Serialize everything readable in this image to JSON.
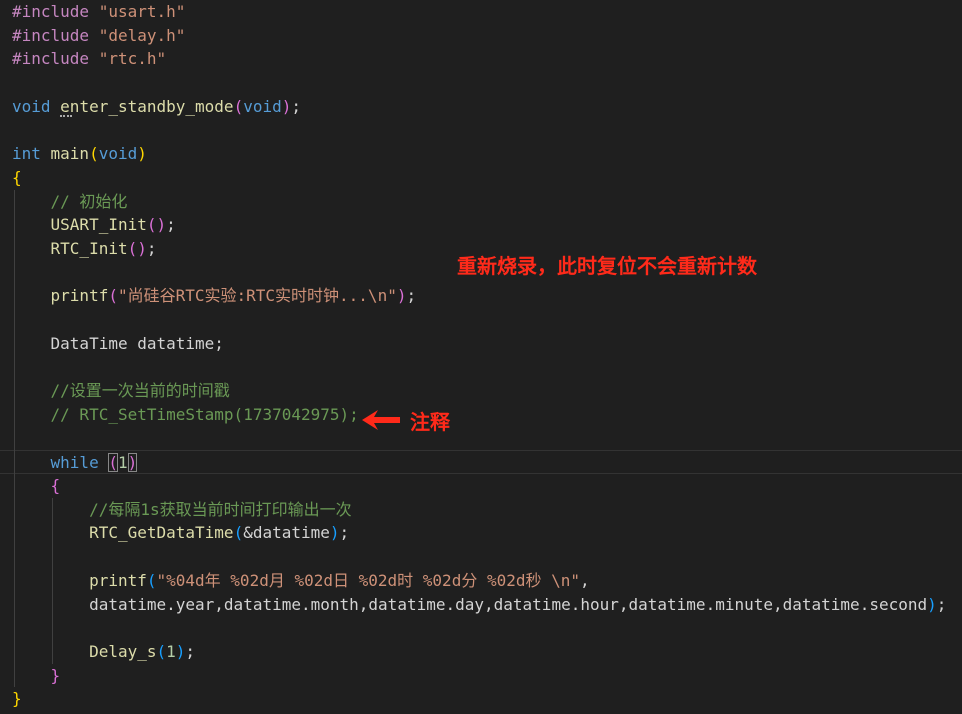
{
  "code_lines": [
    [
      {
        "t": "#include ",
        "c": "t-pp"
      },
      {
        "t": "\"usart.h\"",
        "c": "t-str"
      }
    ],
    [
      {
        "t": "#include ",
        "c": "t-pp"
      },
      {
        "t": "\"delay.h\"",
        "c": "t-str"
      }
    ],
    [
      {
        "t": "#include ",
        "c": "t-pp"
      },
      {
        "t": "\"rtc.h\"",
        "c": "t-str"
      }
    ],
    [],
    [
      {
        "t": "void ",
        "c": "t-kw"
      },
      {
        "t": "enter_standby_mode",
        "c": "t-fn"
      },
      {
        "t": "(",
        "c": "t-b2"
      },
      {
        "t": "void",
        "c": "t-kw"
      },
      {
        "t": ")",
        "c": "t-b2"
      },
      {
        "t": ";",
        "c": "t-plain"
      }
    ],
    [],
    [
      {
        "t": "int ",
        "c": "t-kw"
      },
      {
        "t": "main",
        "c": "t-fn"
      },
      {
        "t": "(",
        "c": "t-b1"
      },
      {
        "t": "void",
        "c": "t-kw"
      },
      {
        "t": ")",
        "c": "t-b1"
      }
    ],
    [
      {
        "t": "{",
        "c": "t-b1"
      }
    ],
    [
      {
        "t": "    "
      },
      {
        "t": "// 初始化",
        "c": "t-cm"
      }
    ],
    [
      {
        "t": "    "
      },
      {
        "t": "USART_Init",
        "c": "t-fn"
      },
      {
        "t": "(",
        "c": "t-b2"
      },
      {
        "t": ")",
        "c": "t-b2"
      },
      {
        "t": ";",
        "c": "t-plain"
      }
    ],
    [
      {
        "t": "    "
      },
      {
        "t": "RTC_Init",
        "c": "t-fn"
      },
      {
        "t": "(",
        "c": "t-b2"
      },
      {
        "t": ")",
        "c": "t-b2"
      },
      {
        "t": ";",
        "c": "t-plain"
      }
    ],
    [],
    [
      {
        "t": "    "
      },
      {
        "t": "printf",
        "c": "t-fn"
      },
      {
        "t": "(",
        "c": "t-b2"
      },
      {
        "t": "\"尚硅谷RTC实验:RTC实时时钟...\\n\"",
        "c": "t-str"
      },
      {
        "t": ")",
        "c": "t-b2"
      },
      {
        "t": ";",
        "c": "t-plain"
      }
    ],
    [],
    [
      {
        "t": "    "
      },
      {
        "t": "DataTime datatime;",
        "c": "t-plain"
      }
    ],
    [],
    [
      {
        "t": "    "
      },
      {
        "t": "//设置一次当前的时间戳",
        "c": "t-cm"
      }
    ],
    [
      {
        "t": "    "
      },
      {
        "t": "// RTC_SetTimeStamp(1737042975);",
        "c": "t-cm"
      }
    ],
    [],
    [
      {
        "t": "    "
      },
      {
        "t": "while ",
        "c": "t-kw"
      },
      {
        "t": "(",
        "c": "t-b2 bm"
      },
      {
        "t": "1",
        "c": "t-num"
      },
      {
        "t": ")",
        "c": "t-b2 bm"
      }
    ],
    [
      {
        "t": "    "
      },
      {
        "t": "{",
        "c": "t-b2"
      }
    ],
    [
      {
        "t": "        "
      },
      {
        "t": "//每隔1s获取当前时间打印输出一次",
        "c": "t-cm"
      }
    ],
    [
      {
        "t": "        "
      },
      {
        "t": "RTC_GetDataTime",
        "c": "t-fn"
      },
      {
        "t": "(",
        "c": "t-b3"
      },
      {
        "t": "&datatime",
        "c": "t-plain"
      },
      {
        "t": ")",
        "c": "t-b3"
      },
      {
        "t": ";",
        "c": "t-plain"
      }
    ],
    [],
    [
      {
        "t": "        "
      },
      {
        "t": "printf",
        "c": "t-fn"
      },
      {
        "t": "(",
        "c": "t-b3"
      },
      {
        "t": "\"%04d年 %02d月 %02d日 %02d时 %02d分 %02d秒 \\n\"",
        "c": "t-str"
      },
      {
        "t": ",",
        "c": "t-plain"
      }
    ],
    [
      {
        "t": "        "
      },
      {
        "t": "datatime.year,datatime.month,datatime.day,datatime.hour,datatime.minute,datatime.second",
        "c": "t-plain"
      },
      {
        "t": ")",
        "c": "t-b3"
      },
      {
        "t": ";",
        "c": "t-plain"
      }
    ],
    [],
    [
      {
        "t": "        "
      },
      {
        "t": "Delay_s",
        "c": "t-fn"
      },
      {
        "t": "(",
        "c": "t-b3"
      },
      {
        "t": "1",
        "c": "t-num"
      },
      {
        "t": ")",
        "c": "t-b3"
      },
      {
        "t": ";",
        "c": "t-plain"
      }
    ],
    [
      {
        "t": "    "
      },
      {
        "t": "}",
        "c": "t-b2"
      }
    ],
    [
      {
        "t": "}",
        "c": "t-b1"
      }
    ]
  ],
  "annotations": {
    "reflash_note": "重新烧录，此时复位不会重新计数",
    "comment_note": "注释"
  },
  "colors": {
    "background": "#1f1f1f",
    "annotation_red": "#ff2a1a"
  }
}
